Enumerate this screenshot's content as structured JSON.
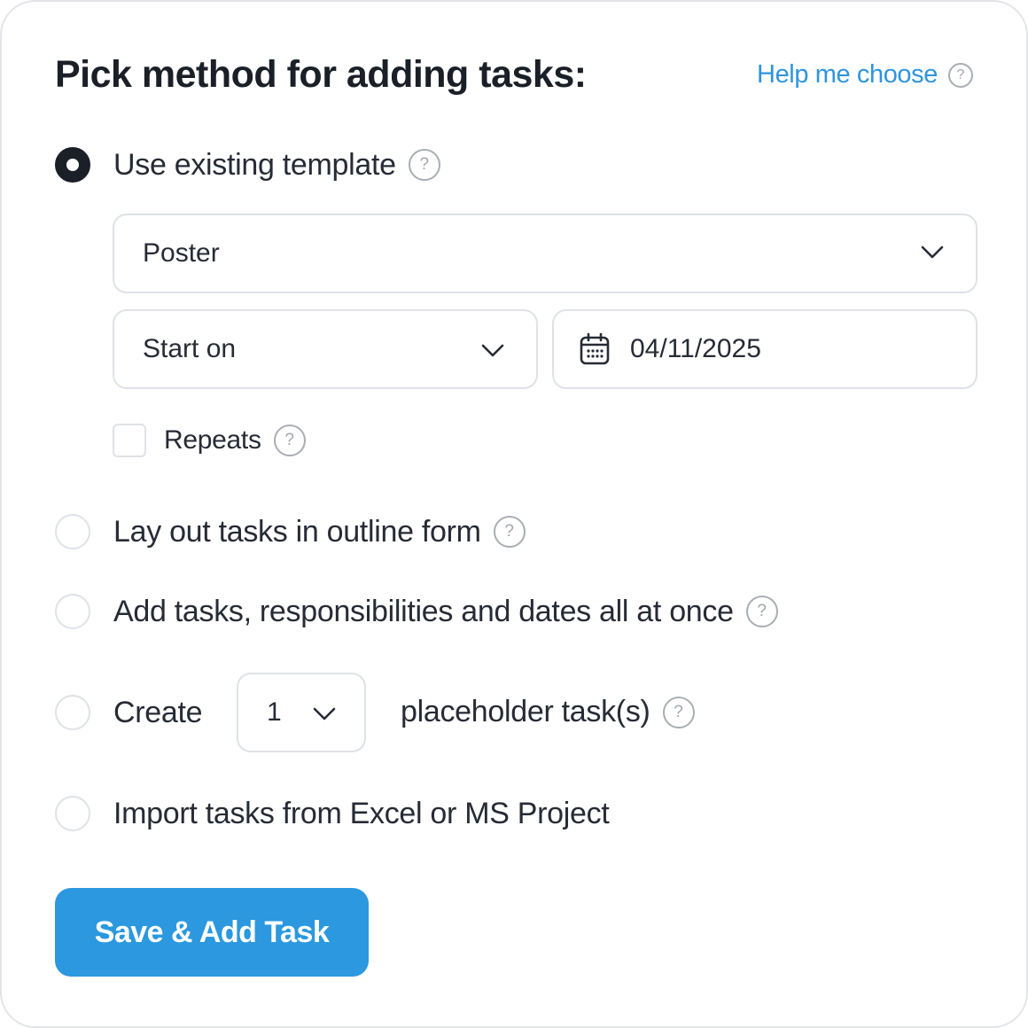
{
  "header": {
    "title": "Pick method for adding tasks:",
    "help_link": "Help me choose",
    "help_icon": "?"
  },
  "options": [
    {
      "label": "Use existing template",
      "selected": true,
      "help_icon": "?"
    },
    {
      "label": "Lay out tasks in outline form",
      "selected": false,
      "help_icon": "?"
    },
    {
      "label": "Add tasks, responsibilities and dates all at once",
      "selected": false,
      "help_icon": "?"
    },
    {
      "label_before": "Create",
      "label_after": "placeholder task(s)",
      "selected": false,
      "help_icon": "?"
    },
    {
      "label": "Import tasks from Excel or MS Project",
      "selected": false
    }
  ],
  "template": {
    "selected": "Poster",
    "start_mode": "Start on",
    "start_date": "04/11/2025",
    "repeats_label": "Repeats",
    "repeats_checked": false,
    "help_icon": "?"
  },
  "placeholder_count": "1",
  "actions": {
    "save_label": "Save & Add Task"
  },
  "colors": {
    "accent": "#2b98df",
    "link": "#2f95dc",
    "text": "#1b1f27",
    "border": "#dfe2e6"
  },
  "icons": [
    "help-icon",
    "chevron-down-icon",
    "calendar-icon"
  ]
}
